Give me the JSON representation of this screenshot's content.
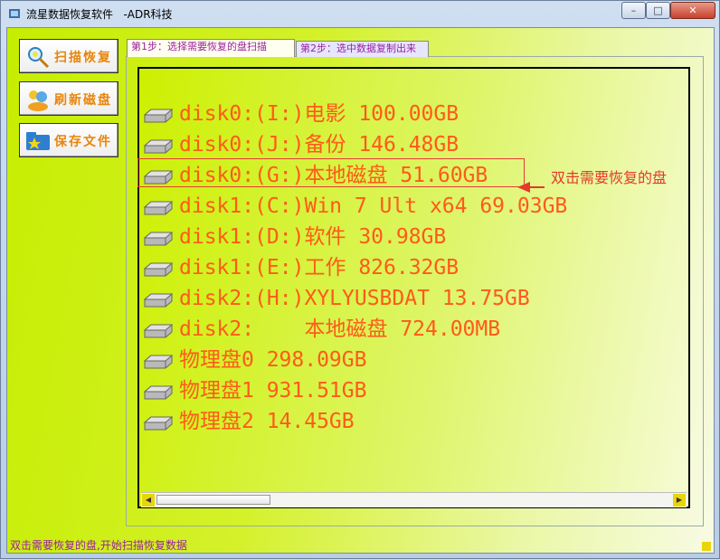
{
  "window": {
    "title": "流星数据恢复软件   -ADR科技",
    "minimize_glyph": "–",
    "maximize_glyph": "□",
    "close_glyph": "✕"
  },
  "sidebar": {
    "buttons": [
      {
        "label": "扫描恢复",
        "icon": "magnifier-icon"
      },
      {
        "label": "刷新磁盘",
        "icon": "people-refresh-icon"
      },
      {
        "label": "保存文件",
        "icon": "star-folder-icon"
      }
    ]
  },
  "tabs": [
    {
      "label": "第1步：选择需要恢复的盘扫描",
      "active": true
    },
    {
      "label": "第2步：选中数据复制出来",
      "active": false
    }
  ],
  "disks": [
    {
      "text": "disk0:(I:)电影 100.00GB"
    },
    {
      "text": "disk0:(J:)备份 146.48GB"
    },
    {
      "text": "disk0:(G:)本地磁盘 51.60GB"
    },
    {
      "text": "disk1:(C:)Win 7 Ult x64 69.03GB"
    },
    {
      "text": "disk1:(D:)软件 30.98GB"
    },
    {
      "text": "disk1:(E:)工作 826.32GB"
    },
    {
      "text": "disk2:(H:)XYLYUSBDAT 13.75GB"
    },
    {
      "text": "disk2:    本地磁盘 724.00MB"
    },
    {
      "text": "物理盘0 298.09GB"
    },
    {
      "text": "物理盘1 931.51GB"
    },
    {
      "text": "物理盘2 14.45GB"
    }
  ],
  "annotation": {
    "text": "双击需要恢复的盘",
    "color": "#e23a2a"
  },
  "status": {
    "text": "双击需要恢复的盘,开始扫描恢复数据"
  },
  "colors": {
    "accent_lime": "#c6ee00",
    "disk_text": "#ff5a1a",
    "button_text": "#e8850a",
    "tab_text": "#9b1fa0"
  }
}
